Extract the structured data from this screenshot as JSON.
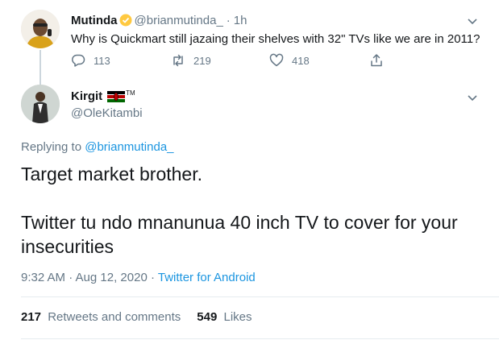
{
  "parent_tweet": {
    "name": "Mutinda",
    "handle": "@brianmutinda_",
    "separator": "·",
    "time": "1h",
    "text": "Why is Quickmart still jazaing their shelves with 32\" TVs like we are in 2011?",
    "replies": "113",
    "retweets": "219",
    "likes": "418"
  },
  "main_tweet": {
    "name": "Kirgit",
    "tm": "TM",
    "handle": "@OleKitambi",
    "replying_prefix": "Replying to",
    "replying_to": "@brianmutinda_",
    "line1": "Target market brother.",
    "line2": "Twitter tu ndo mnanunua 40 inch TV to cover for your",
    "line3": "insecurities",
    "timestamp": "9:32 AM · Aug 12, 2020 ·",
    "source": "Twitter for Android",
    "retweets_count": "217",
    "retweets_label": "Retweets and comments",
    "likes_count": "549",
    "likes_label": "Likes"
  },
  "colors": {
    "link": "#1b95e0",
    "secondary_text": "#657786",
    "primary_text": "#14171a",
    "verified_badge": "#ffc940"
  }
}
